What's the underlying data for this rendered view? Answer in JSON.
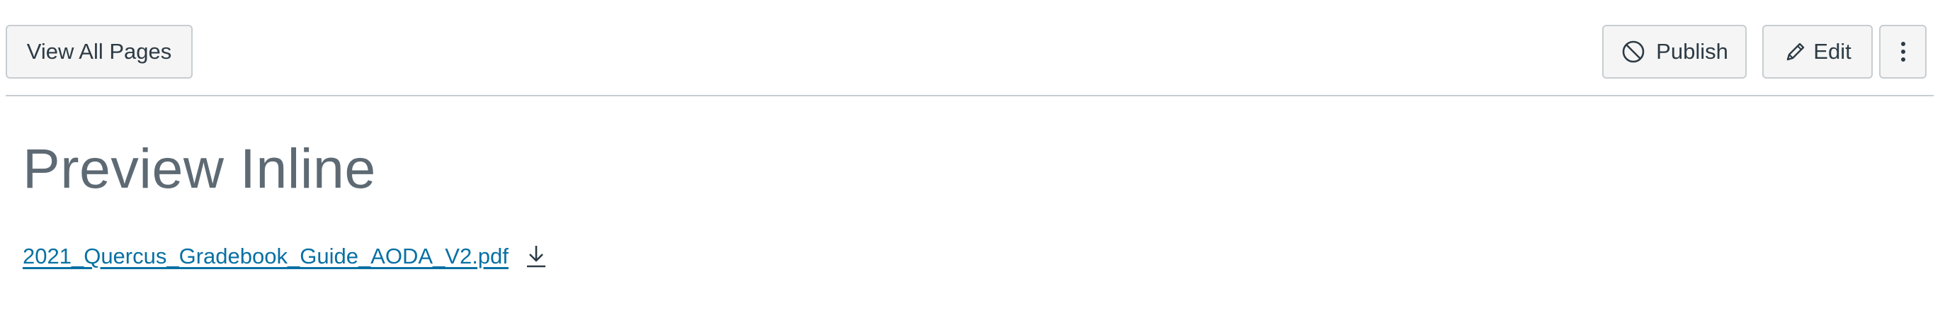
{
  "toolbar": {
    "view_all_label": "View All Pages",
    "publish_label": "Publish",
    "edit_label": "Edit",
    "publish_icon": "no-symbol-icon",
    "edit_icon": "pencil-icon",
    "more_icon": "kebab-menu-icon"
  },
  "main": {
    "title": "Preview Inline",
    "file_name": "2021_Quercus_Gradebook_Guide_AODA_V2.pdf",
    "download_icon": "download-icon"
  },
  "colors": {
    "link": "#0770a3",
    "title": "#5e6a73",
    "text": "#2d3b45",
    "button_bg": "#f5f5f5",
    "border": "#c7cdd1"
  }
}
